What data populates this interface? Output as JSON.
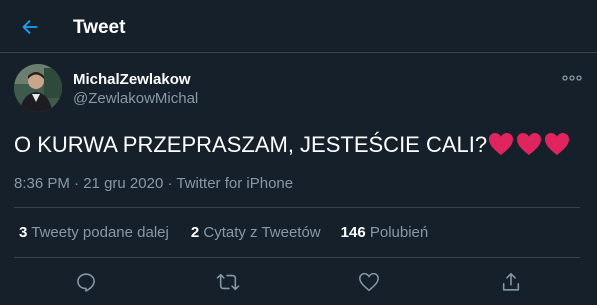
{
  "header": {
    "title": "Tweet",
    "back_icon": "arrow-left-icon"
  },
  "colors": {
    "background": "#15202b",
    "accent": "#1da1f2",
    "secondary_text": "#8899a6",
    "divider": "#38444d",
    "heart": "#e0245e"
  },
  "author": {
    "display_name": "MichalZewlakow",
    "handle": "@ZewlakowMichal"
  },
  "tweet": {
    "text": "O KURWA PRZEPRASZAM, JESTEŚCIE CALI?",
    "emoji": [
      "red-heart-icon",
      "red-heart-icon",
      "red-heart-icon"
    ],
    "time": "8:36 PM",
    "separator": "·",
    "date": "21 gru 2020",
    "source": "Twitter for iPhone"
  },
  "stats": {
    "retweets": {
      "count": "3",
      "label": "Tweety podane dalej"
    },
    "quotes": {
      "count": "2",
      "label": "Cytaty z Tweetów"
    },
    "likes": {
      "count": "146",
      "label": "Polubień"
    }
  },
  "actions": [
    "reply-icon",
    "retweet-icon",
    "like-icon",
    "share-icon"
  ]
}
